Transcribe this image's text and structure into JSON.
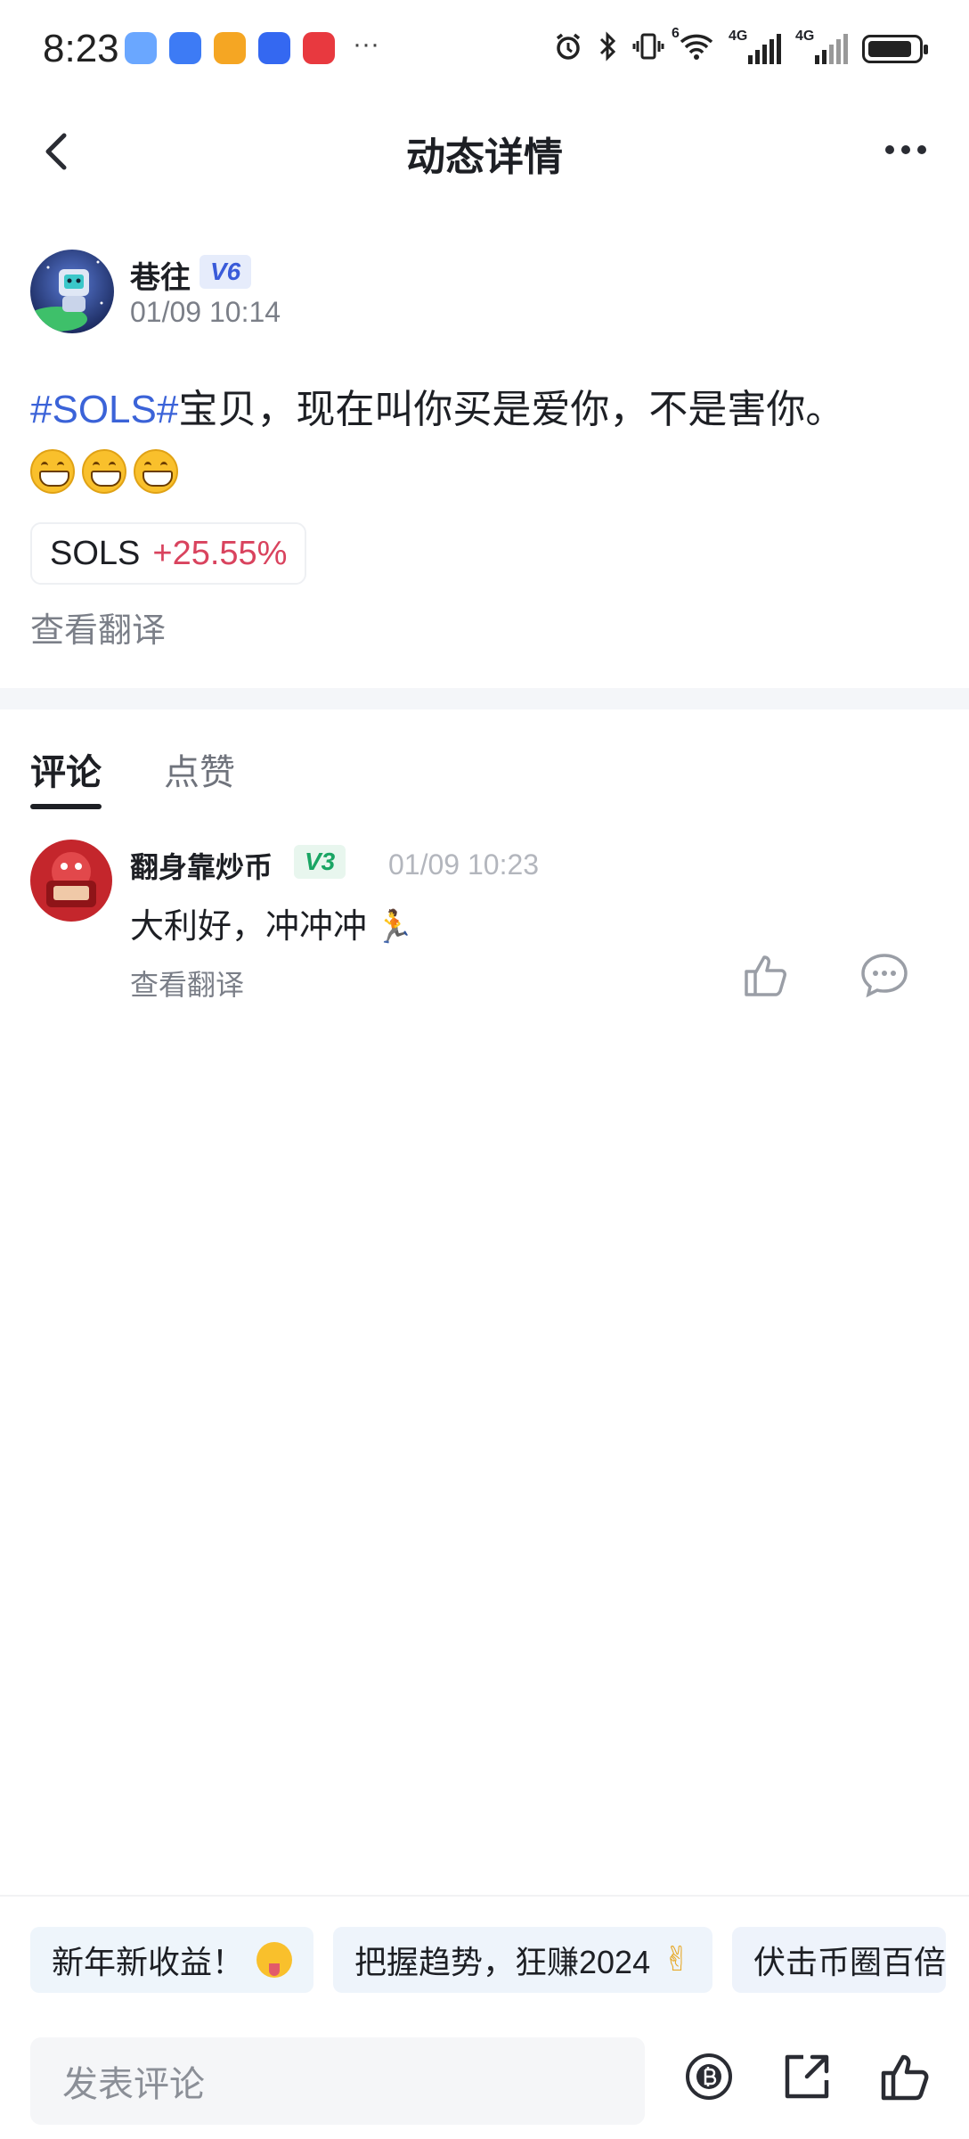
{
  "status_bar": {
    "time": "8:23",
    "app_icon_colors": [
      "#6aa7ff",
      "#3d7bf5",
      "#f5a623",
      "#3468f1",
      "#e8393f"
    ],
    "more_indicator": "···",
    "icons": [
      "alarm-icon",
      "bluetooth-icon",
      "vibrate-icon",
      "wifi-icon",
      "signal-4g-icon",
      "signal-4g-icon",
      "battery-icon"
    ],
    "net_label_1": "4G",
    "net_label_2": "4G",
    "wifi_label": "6"
  },
  "header": {
    "title": "动态详情"
  },
  "post": {
    "author_name": "巷往",
    "author_badge": "V6",
    "timestamp": "01/09 10:14",
    "hashtag": "#SOLS#",
    "text": "宝贝，现在叫你买是爱你，不是害你。",
    "emoji_count": 3,
    "ticker": {
      "symbol": "SOLS",
      "change": "+25.55%"
    },
    "translate_label": "查看翻译"
  },
  "tabs": [
    {
      "label": "评论",
      "active": true
    },
    {
      "label": "点赞",
      "active": false
    }
  ],
  "comments": [
    {
      "author_name": "翻身靠炒币",
      "badge": "V3",
      "timestamp": "01/09 10:23",
      "text": "大利好，冲冲冲",
      "emoji": "🏃",
      "translate_label": "查看翻译"
    }
  ],
  "quick_replies": [
    {
      "label": "新年新收益！"
    },
    {
      "label": "把握趋势，狂赚2024"
    },
    {
      "label": "伏击币圈百倍"
    }
  ],
  "bottom_bar": {
    "input_placeholder": "发表评论"
  },
  "colors": {
    "hashtag": "#3b63d8",
    "price_change_up": "#d9435e",
    "badge_v6": "#3a5bd9",
    "badge_v3": "#1aa564"
  }
}
